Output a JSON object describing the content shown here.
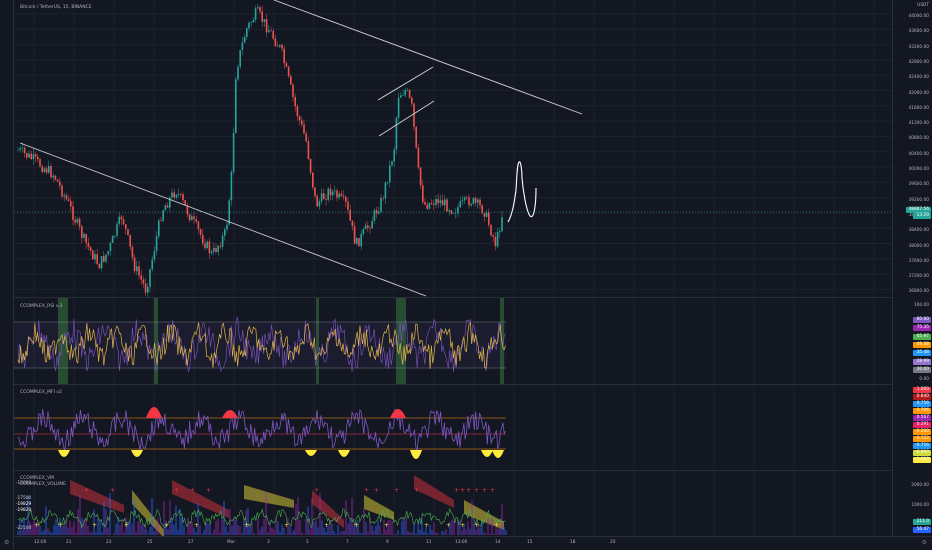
{
  "main": {
    "symbol_line": "Bitcoin / TetherUS, 15, BINANCE",
    "currency": "USDT",
    "price_ticks": [
      "44000.00",
      "43600.00",
      "43200.00",
      "42800.00",
      "42400.00",
      "42000.00",
      "41600.00",
      "41200.00",
      "40800.00",
      "40400.00",
      "40000.00",
      "39600.00",
      "39200.00",
      "38800.00",
      "38400.00",
      "38000.00",
      "37600.00",
      "37200.00",
      "36800.00"
    ],
    "current_price": "38887.56",
    "countdown": "13:29",
    "last_color": "#26a69a"
  },
  "rsi": {
    "title": "CCOMPLEX_RSI v.2",
    "ticks": [
      "100.00",
      "0.00"
    ],
    "badges": [
      {
        "text": "80.00",
        "color": "#7e57c2"
      },
      {
        "text": "75.35",
        "color": "#9c27b0"
      },
      {
        "text": "65.97",
        "color": "#4caf50"
      },
      {
        "text": "49.38",
        "color": "#ff9800"
      },
      {
        "text": "35.48",
        "color": "#2196f3"
      },
      {
        "text": "28.99",
        "color": "#9575cd"
      },
      {
        "text": "20.00",
        "color": "#787b86"
      }
    ]
  },
  "mfi": {
    "title": "CCOMPLEX_MFI v2",
    "ticks": [
      "0.00"
    ],
    "badges": [
      {
        "text": "1.000",
        "color": "#f23645"
      },
      {
        "text": "0.840",
        "color": "#b71c1c"
      },
      {
        "text": "0.756",
        "color": "#2196f3"
      },
      {
        "text": "0.706",
        "color": "#ff9800"
      },
      {
        "text": "0.567",
        "color": "#9c27b0"
      },
      {
        "text": "0.291",
        "color": "#e91e63"
      },
      {
        "text": "-0.200",
        "color": "#ff9800"
      },
      {
        "text": "-0.722",
        "color": "#ff9800"
      },
      {
        "text": "-0.756",
        "color": "#2196f3"
      },
      {
        "text": "-0.890",
        "color": "#cddc39"
      },
      {
        "text": "-1.000",
        "color": "#ffeb3b"
      }
    ]
  },
  "vol": {
    "title1": "CCOMPLEX_VM",
    "title2": "CCOMPLEX_VOLUME",
    "left_labels": [
      {
        "text": "-15000",
        "color": "#d1d4dc"
      },
      {
        "text": "-17500",
        "color": "#d1d4dc"
      },
      {
        "text": "-19829",
        "color": "#ffffff"
      },
      {
        "text": "-19820",
        "color": "#ffffff"
      },
      {
        "text": "-22500",
        "color": "#d1d4dc"
      }
    ],
    "ticks": [
      "2000.00",
      "1000.00"
    ],
    "badges": [
      {
        "text": "211.0",
        "color": "#26a69a"
      },
      {
        "text": "56.47",
        "color": "#2962ff"
      }
    ]
  },
  "time_labels": [
    "12:00",
    "21",
    "23",
    "25",
    "27",
    "Mar",
    "3",
    "5",
    "7",
    "9",
    "11",
    "13:00",
    "14",
    "15",
    "18",
    "20"
  ],
  "colors": {
    "bull": "#26a69a",
    "bear": "#ef5350",
    "rsi_line": "#e0b64a",
    "rsi_line2": "#7e57c2",
    "mfi_line": "#7e57c2",
    "highlight": "#ffeb3b",
    "red_fill": "#f23645"
  }
}
